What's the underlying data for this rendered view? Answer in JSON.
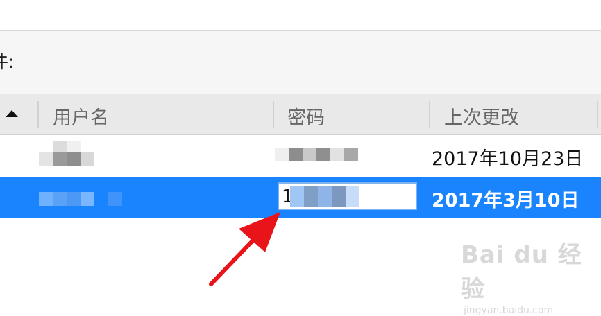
{
  "filter": {
    "label": "件:"
  },
  "columns": {
    "username": "用户名",
    "password": "密码",
    "last_changed": "上次更改"
  },
  "rows": [
    {
      "last_changed": "2017年10月23日",
      "selected": false
    },
    {
      "last_changed": "2017年3月10日",
      "selected": true,
      "password_field_value": "1"
    }
  ],
  "watermark": {
    "logo_text": "Bai du 经验",
    "url": "jingyan.baidu.com"
  },
  "colors": {
    "selection": "#1a84ff",
    "header_bg": "#e9e9e9",
    "arrow": "#e8141a"
  },
  "icons": [
    "sort-ascending-icon",
    "annotation-arrow-icon"
  ]
}
